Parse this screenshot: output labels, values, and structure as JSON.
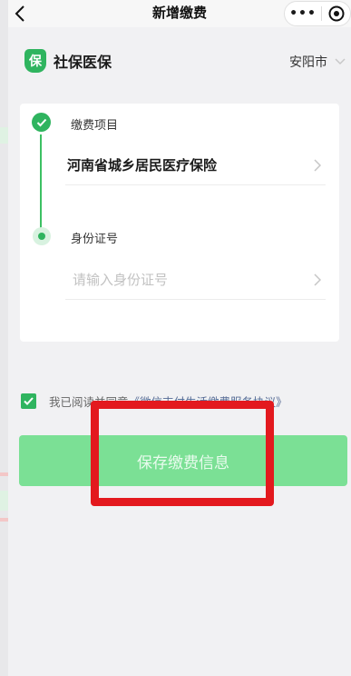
{
  "navbar": {
    "title": "新增缴费",
    "more_label": "•••"
  },
  "brand": {
    "logo_char": "保",
    "name": "社保医保"
  },
  "location": {
    "city": "安阳市"
  },
  "form": {
    "step1": {
      "label": "缴费项目",
      "value": "河南省城乡居民医疗保险"
    },
    "step2": {
      "label": "身份证号",
      "placeholder": "请输入身份证号",
      "value": ""
    }
  },
  "agreement": {
    "checked": true,
    "prefix": "我已阅读并同意",
    "link": "《微信支付生活缴费服务协议》"
  },
  "save_button": {
    "label": "保存缴费信息"
  },
  "colors": {
    "brand_green": "#2fb45f",
    "button_green": "#7be095",
    "annotation_red": "#e3191e",
    "link_blue": "#576b95"
  }
}
